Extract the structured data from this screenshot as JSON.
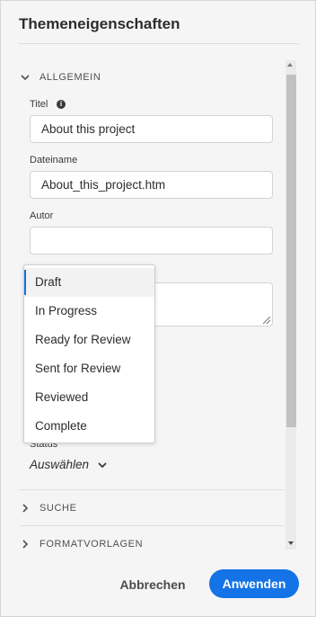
{
  "dialog": {
    "title": "Themeneigenschaften"
  },
  "sections": {
    "general": {
      "label": "ALLGEMEIN",
      "expanded": true,
      "icon": "chevron-down-icon"
    },
    "search": {
      "label": "SUCHE",
      "expanded": false,
      "icon": "chevron-right-icon"
    },
    "templates": {
      "label": "FORMATVORLAGEN",
      "expanded": false,
      "icon": "chevron-right-icon"
    }
  },
  "fields": {
    "title": {
      "label": "Titel",
      "value": "About this project",
      "info_icon": "info-icon"
    },
    "filename": {
      "label": "Dateiname",
      "value": "About_this_project.htm"
    },
    "author": {
      "label": "Autor",
      "value": ""
    },
    "status": {
      "label": "Status",
      "value": "Auswählen",
      "icon": "chevron-down-icon"
    }
  },
  "status_dropdown": {
    "options": [
      "Draft",
      "In Progress",
      "Ready for Review",
      "Sent for Review",
      "Reviewed",
      "Complete"
    ],
    "highlighted": "Draft"
  },
  "buttons": {
    "cancel": "Abbrechen",
    "apply": "Anwenden"
  },
  "colors": {
    "accent": "#1473e6",
    "background": "#f5f5f5"
  }
}
